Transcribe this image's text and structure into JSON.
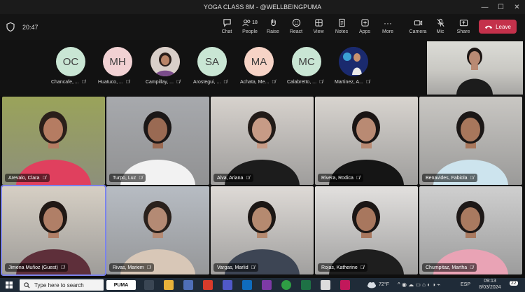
{
  "window": {
    "title": "YOGA CLASS 8M - @WELLBEINGPUMA",
    "controls": [
      "—",
      "☐",
      "✕"
    ]
  },
  "toolbar": {
    "timer": "20:47",
    "chat": "Chat",
    "people": "People",
    "people_count": "18",
    "raise": "Raise",
    "react": "React",
    "view": "View",
    "notes": "Notes",
    "apps": "Apps",
    "more": "More",
    "camera": "Camera",
    "mic": "Mic",
    "share": "Share",
    "leave": "Leave"
  },
  "strip": [
    {
      "initials": "OC",
      "name": "Chancafe, ...",
      "color": "#c9e6d4"
    },
    {
      "initials": "MH",
      "name": "Huatuco, ...",
      "color": "#f1d1d3"
    },
    {
      "initials": "",
      "name": "Campillay, ...",
      "color": "#c98d7a"
    },
    {
      "initials": "SA",
      "name": "Arostegui, ...",
      "color": "#c9e6d4"
    },
    {
      "initials": "MA",
      "name": "Achata, Me...",
      "color": "#f6d3c6"
    },
    {
      "initials": "MC",
      "name": "Calabretto, ...",
      "color": "#c9e6d4"
    },
    {
      "initials": "",
      "name": "Martinez, A...",
      "color": "#2a3b8f"
    }
  ],
  "tiles": [
    {
      "name": "Arevalo, Clara",
      "bg": "#9aa35a",
      "shirt": "#e0405e",
      "skin": "#b57c62",
      "hair": "#2a1f1a"
    },
    {
      "name": "Turpo, Luz",
      "bg": "#a7a9ad",
      "shirt": "#f2f2f2",
      "skin": "#9a6a53",
      "hair": "#1b1717"
    },
    {
      "name": "Alva, Ariana",
      "bg": "#d7d2cd",
      "shirt": "#1c1c1c",
      "skin": "#c79b86",
      "hair": "#221b18"
    },
    {
      "name": "Rivera, Rodica",
      "bg": "#d8d4cf",
      "shirt": "#151515",
      "skin": "#b98a73",
      "hair": "#1a1514"
    },
    {
      "name": "Benavides, Fabiola",
      "bg": "#c9c7c3",
      "shirt": "#cde4ee",
      "skin": "#a8775c",
      "hair": "#1b1716"
    },
    {
      "name": "Jimena Muñoz (Guest)",
      "bg": "#d6cfc4",
      "shirt": "#5e2f3a",
      "skin": "#b07f67",
      "hair": "#201815"
    },
    {
      "name": "Rivas, Mariem",
      "bg": "#b7bcc3",
      "shirt": "#d8c7b7",
      "skin": "#b48a74",
      "hair": "#2a211c"
    },
    {
      "name": "Vargas, Marlid",
      "bg": "#dedad6",
      "shirt": "#3d4554",
      "skin": "#b58a70",
      "hair": "#1c1715"
    },
    {
      "name": "Rojas, Katherine",
      "bg": "#e2e0de",
      "shirt": "#1e1e1e",
      "skin": "#a8775e",
      "hair": "#1b1615"
    },
    {
      "name": "Chumpitaz, Martha",
      "bg": "#cfcfcf",
      "shirt": "#e9a3b5",
      "skin": "#a97a60",
      "hair": "#1d1817"
    }
  ],
  "taskbar": {
    "search": "Type here to search",
    "weather": "72°F",
    "lang": "ESP",
    "time": "09:13",
    "date": "8/03/2024",
    "notif": "22"
  }
}
